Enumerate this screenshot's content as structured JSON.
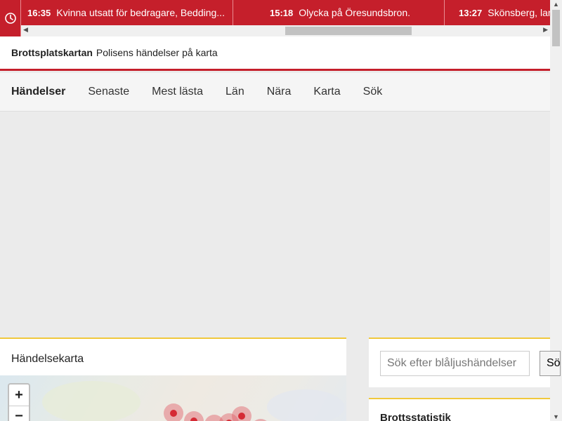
{
  "ticker": {
    "items": [
      {
        "time": "16:35",
        "text": "Kvinna utsatt för bedragare, Bedding..."
      },
      {
        "time": "15:18",
        "text": "Olycka på Öresundsbron."
      },
      {
        "time": "13:27",
        "text": "Skönsberg, larm"
      }
    ]
  },
  "header": {
    "site_name": "Brottsplatskartan",
    "tagline": "Polisens händelser på karta"
  },
  "nav": {
    "items": [
      "Händelser",
      "Senaste",
      "Mest lästa",
      "Län",
      "Nära",
      "Karta",
      "Sök"
    ],
    "active": "Händelser"
  },
  "map_card": {
    "title": "Händelsekarta",
    "zoom_in": "+",
    "zoom_out": "−"
  },
  "search": {
    "placeholder": "Sök efter blåljushändelser",
    "button_label": "Sök"
  },
  "stats": {
    "title": "Brottsstatistik"
  },
  "colors": {
    "brand_red": "#c51f2b",
    "accent_yellow": "#f0c83c",
    "marker": "#d52b35"
  },
  "icons": {
    "ticker_clock": "clock-icon"
  }
}
